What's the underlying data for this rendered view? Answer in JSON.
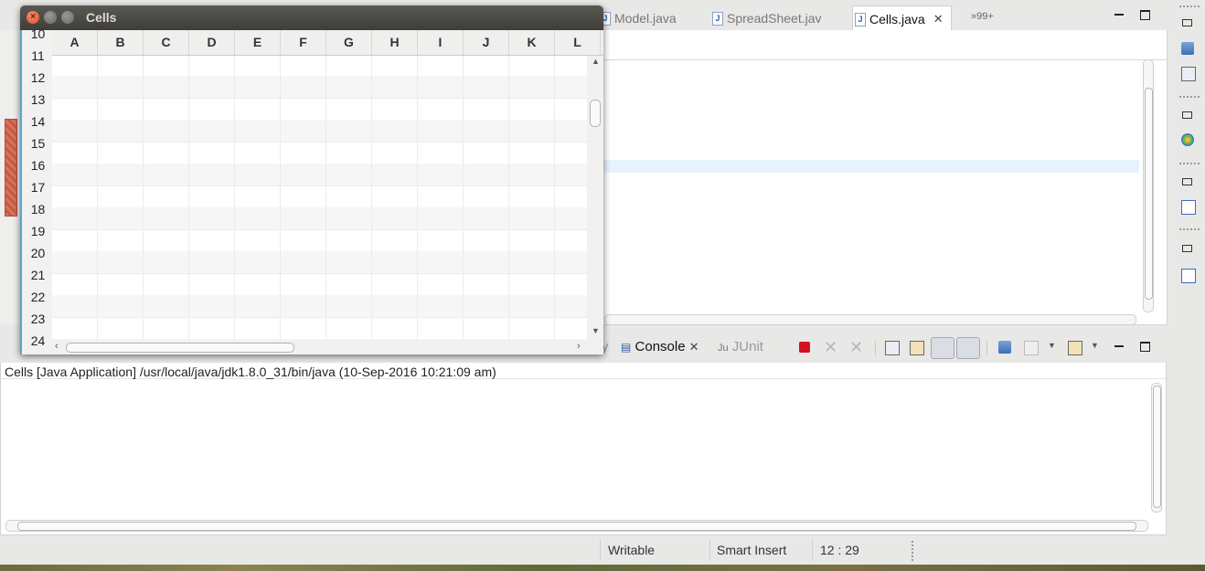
{
  "editor": {
    "tabs": [
      {
        "label": "Model.java"
      },
      {
        "label": "SpreadSheet.jav"
      },
      {
        "label": "Cells.java"
      }
    ],
    "overflow_label": "»99+"
  },
  "bottom_panel": {
    "tab_partial_label": "y",
    "tabs": [
      {
        "label": "Console"
      },
      {
        "label": "JUnit"
      }
    ]
  },
  "console": {
    "header": "Cells [Java Application] /usr/local/java/jdk1.8.0_31/bin/java (10-Sep-2016 10:21:09 am)"
  },
  "status_bar": {
    "mode": "Writable",
    "insert_mode": "Smart Insert",
    "position": "12 : 29"
  },
  "cells_window": {
    "title": "Cells",
    "columns": [
      "A",
      "B",
      "C",
      "D",
      "E",
      "F",
      "G",
      "H",
      "I",
      "J",
      "K",
      "L"
    ],
    "rows": [
      "10",
      "11",
      "12",
      "13",
      "14",
      "15",
      "16",
      "17",
      "18",
      "19",
      "20",
      "21",
      "22",
      "23",
      "24"
    ]
  },
  "icons": {
    "stop": "stop-icon",
    "remove_launch": "remove-launch-icon",
    "remove_all": "remove-all-terminated-icon",
    "clear_console": "clear-console-icon",
    "scroll_lock": "scroll-lock-icon",
    "pin_console": "pin-console-icon",
    "open_console": "open-console-icon"
  },
  "colors": {
    "stop_red": "#d5101f",
    "titlebar": "#4b4a45",
    "selection_line": "#e8f2fe"
  }
}
